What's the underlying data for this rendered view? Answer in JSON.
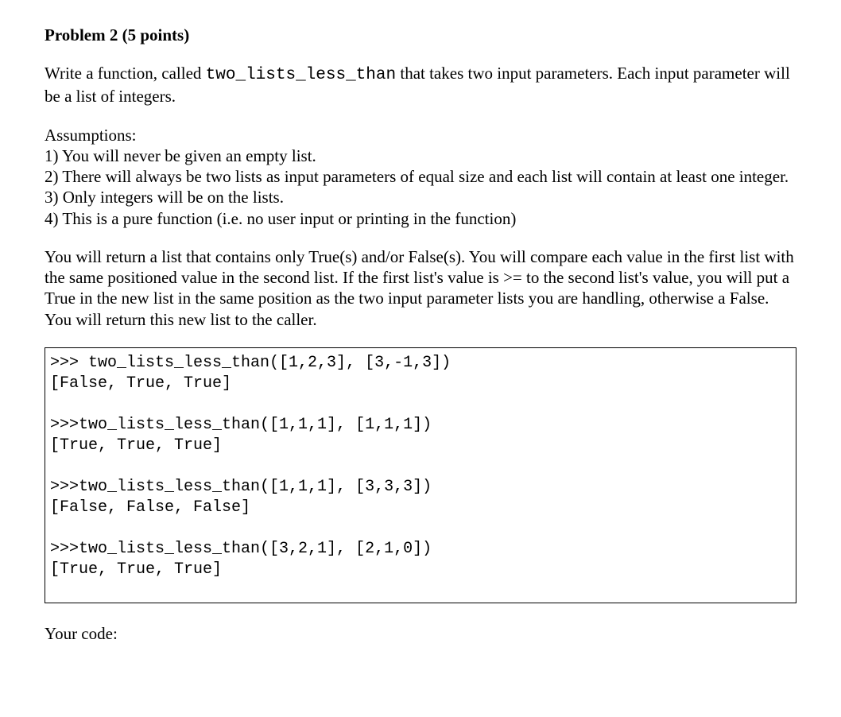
{
  "title": "Problem 2 (5 points)",
  "intro": {
    "prefix": "Write a function, called ",
    "func_name": "two_lists_less_than",
    "suffix": " that takes two input parameters.  Each input parameter will be a list of integers."
  },
  "assumptions_heading": "Assumptions:",
  "assumptions": [
    "1)  You will never be given an empty list.",
    "2)  There will always be two lists as input parameters of equal size and each list will contain at least one integer.",
    "3)  Only integers will be on the lists.",
    "4)   This is a pure function (i.e. no user input or printing in the function)"
  ],
  "behavior": "You will return a list that contains only True(s) and/or False(s).  You will compare each value in the first list with the same positioned value in the second list.  If the first list's value is >= to the second list's value, you will put a True in the new list in the same position as the two input parameter lists you are handling, otherwise a False.  You will return this new list to the caller.",
  "code_examples": ">>> two_lists_less_than([1,2,3], [3,-1,3])\n[False, True, True]\n\n>>>two_lists_less_than([1,1,1], [1,1,1])\n[True, True, True]\n\n>>>two_lists_less_than([1,1,1], [3,3,3])\n[False, False, False]\n\n>>>two_lists_less_than([3,2,1], [2,1,0])\n[True, True, True]",
  "your_code_label": "Your code:"
}
